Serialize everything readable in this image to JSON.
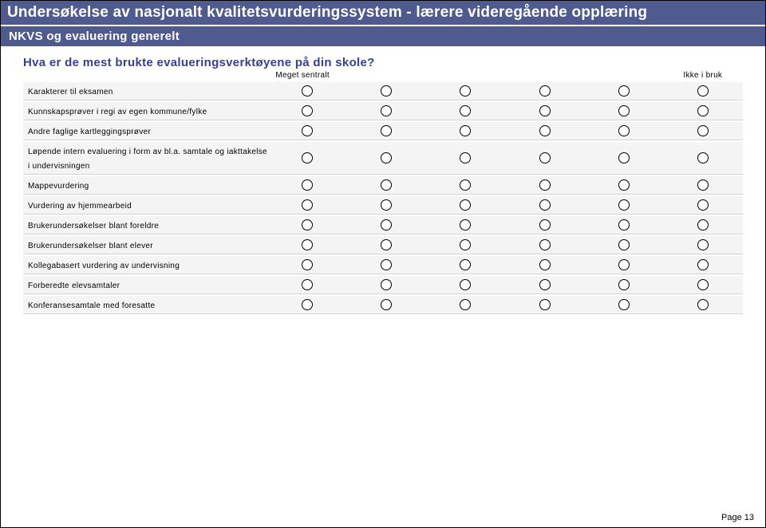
{
  "survey_title": "Undersøkelse av nasjonalt kvalitetsvurderingssystem - lærere videregående opplæring",
  "section_title": "NKVS og evaluering generelt",
  "question": "Hva er de mest brukte evalueringsverktøyene på din skole?",
  "scale_left": "Meget sentralt",
  "scale_right": "Ikke i bruk",
  "columns": 6,
  "rows": [
    {
      "label": "Karakterer til eksamen"
    },
    {
      "label": "Kunnskapsprøver i regi av egen kommune/fylke"
    },
    {
      "label": "Andre faglige kartleggingsprøver"
    },
    {
      "label": "Løpende intern evaluering i form av bl.a. samtale og iakttakelse i undervisningen"
    },
    {
      "label": "Mappevurdering"
    },
    {
      "label": "Vurdering av hjemmearbeid"
    },
    {
      "label": "Brukerundersøkelser blant foreldre"
    },
    {
      "label": "Brukerundersøkelser blant elever"
    },
    {
      "label": "Kollegabasert vurdering av undervisning"
    },
    {
      "label": "Forberedte elevsamtaler"
    },
    {
      "label": "Konferansesamtale med foresatte"
    }
  ],
  "page_label": "Page 13"
}
